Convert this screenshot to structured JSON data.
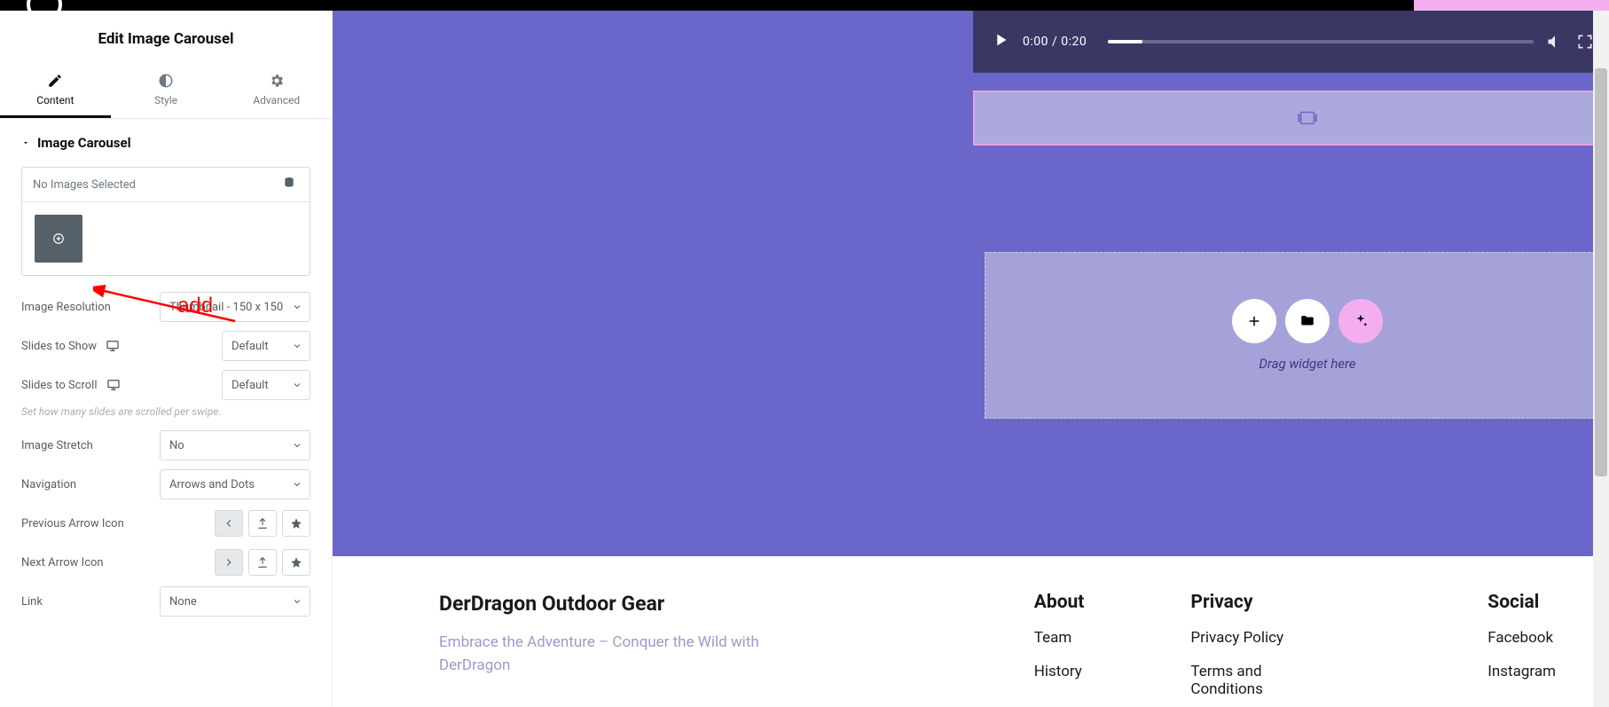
{
  "sidebar": {
    "title": "Edit Image Carousel",
    "tabs": {
      "content": "Content",
      "style": "Style",
      "advanced": "Advanced"
    },
    "section": "Image Carousel",
    "no_images": "No Images Selected",
    "image_resolution": {
      "label": "Image Resolution",
      "value": "Thumbnail - 150 x 150"
    },
    "slides_show": {
      "label": "Slides to Show",
      "value": "Default"
    },
    "slides_scroll": {
      "label": "Slides to Scroll",
      "value": "Default",
      "hint": "Set how many slides are scrolled per swipe."
    },
    "image_stretch": {
      "label": "Image Stretch",
      "value": "No"
    },
    "navigation": {
      "label": "Navigation",
      "value": "Arrows and Dots"
    },
    "prev_arrow": {
      "label": "Previous Arrow Icon"
    },
    "next_arrow": {
      "label": "Next Arrow Icon"
    },
    "link": {
      "label": "Link",
      "value": "None"
    }
  },
  "video": {
    "time": "0:00 / 0:20"
  },
  "drop": {
    "text": "Drag widget here"
  },
  "footer": {
    "brand": "DerDragon Outdoor Gear",
    "tagline": "Embrace the Adventure – Conquer the Wild with DerDragon",
    "about": {
      "title": "About",
      "i1": "Team",
      "i2": "History"
    },
    "privacy": {
      "title": "Privacy",
      "i1": "Privacy Policy",
      "i2": "Terms and Conditions"
    },
    "social": {
      "title": "Social",
      "i1": "Facebook",
      "i2": "Instagram"
    }
  },
  "annotation": {
    "label": "add"
  }
}
